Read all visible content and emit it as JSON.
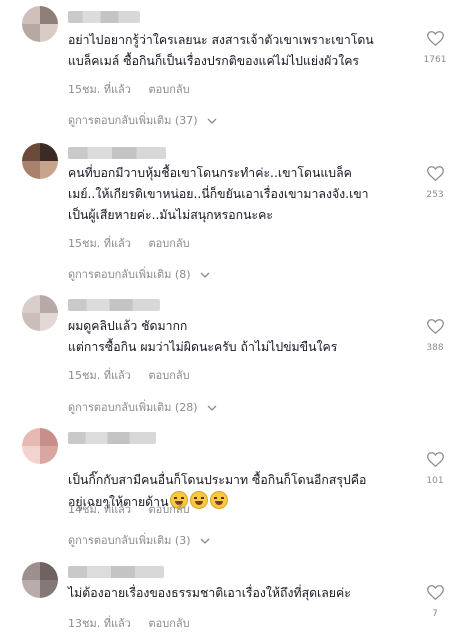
{
  "comments": [
    {
      "text": "อย่าไปอยากรู้ว่าใครเลยนะ สงสารเจ้าตัวเขาเพราะเขาโดน\nแบล็คเมล์ ซื้อกินก็เป็นเรื่องปรกติของแค่ไม่ไปแย่งผัวใคร",
      "time": "15ชม. ที่แล้ว",
      "reply_label": "ตอบกลับ",
      "view_replies": "ดูการตอบกลับเพิ่มเติม (37)",
      "likes": "1761",
      "avatar_colors": [
        "#cdbfba",
        "#8f7d78",
        "#b8a8a2",
        "#d9ccc8"
      ]
    },
    {
      "text": "คนที่บอกมีวาบหุ้มชื้อเขาโดนกระทำค่ะ..เขาโดนแบล็ค\nเมย์..ให้เกียรติเขาหน่อย..นี่ก็ขยันเอาเรื่องเขามาลงจัง.เขา\nเป็นผู้เสียหายค่ะ..มันไม่สนุกหรอกนะคะ",
      "time": "15ชม. ที่แล้ว",
      "reply_label": "ตอบกลับ",
      "view_replies": "ดูการตอบกลับเพิ่มเติม (8)",
      "likes": "253",
      "avatar_colors": [
        "#6b4a3a",
        "#3a2b26",
        "#a8826c",
        "#c9a48c"
      ]
    },
    {
      "text": "ผมดูคลิปแล้ว ชัดมากก\nแต่การซื้อกิน ผมว่าไม่ผิดนะครับ ถ้าไม่ไปข่มขืนใคร",
      "time": "15ชม. ที่แล้ว",
      "reply_label": "ตอบกลับ",
      "view_replies": "ดูการตอบกลับเพิ่มเติม (28)",
      "likes": "388",
      "avatar_colors": [
        "#d8cfcd",
        "#b9a9a6",
        "#cbbdb9",
        "#e2d9d7"
      ]
    },
    {
      "text": "เป็นกิ๊กกับสามีคนอื่นก็โดนประมาท ซื้อกินก็โดนอีกสรุปคือ\nอยู่เฉยๆให้ตายด้าน",
      "time": "14ชม. ที่แล้ว",
      "reply_label": "ตอบกลับ",
      "view_replies": "ดูการตอบกลับเพิ่มเติม (3)",
      "likes": "101",
      "avatar_colors": [
        "#e6b9b3",
        "#c88f8a",
        "#f1d3cf",
        "#d9a7a2"
      ]
    },
    {
      "text": "ไม่ต้องอายเรื่องของธรรมชาติเอาเรื่องให้ถึงที่สุดเลยค่ะ",
      "time": "13ชม. ที่แล้ว",
      "reply_label": "ตอบกลับ",
      "likes": "7",
      "avatar_colors": [
        "#9c8f8d",
        "#6f6261",
        "#b9adab",
        "#857877"
      ]
    }
  ]
}
